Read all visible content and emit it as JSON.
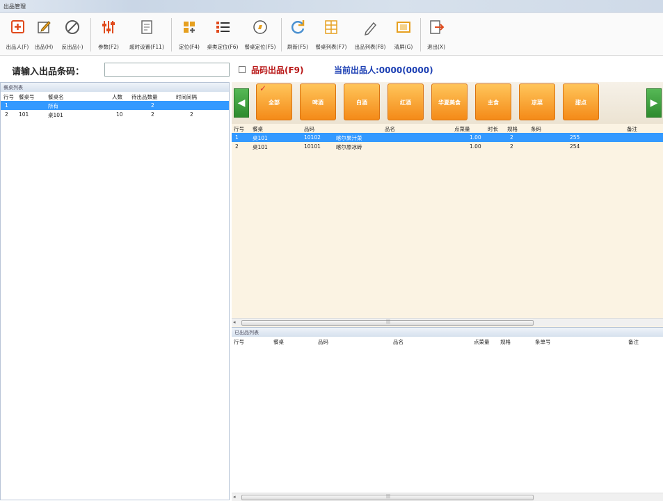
{
  "window": {
    "title": "出品管理"
  },
  "toolbar": {
    "items": [
      {
        "label": "出品人(F)",
        "icon": "plus-box-icon"
      },
      {
        "label": "出品(H)",
        "icon": "edit-icon"
      },
      {
        "label": "反出品(-)",
        "icon": "cancel-circle-icon"
      },
      {
        "label": "参数(F2)",
        "icon": "sliders-icon"
      },
      {
        "label": "超时设置(F11)",
        "icon": "timer-icon"
      },
      {
        "label": "定位(F4)",
        "icon": "grid-plus-icon"
      },
      {
        "label": "桌类定位(F6)",
        "icon": "list-icon"
      },
      {
        "label": "餐桌定位(F5)",
        "icon": "compass-icon"
      },
      {
        "label": "刷新(F5)",
        "icon": "refresh-icon"
      },
      {
        "label": "餐桌列表(F7)",
        "icon": "table-grid-icon"
      },
      {
        "label": "出品列表(F8)",
        "icon": "pencil-icon"
      },
      {
        "label": "清屏(G)",
        "icon": "screen-icon"
      },
      {
        "label": "退出(X)",
        "icon": "exit-icon"
      }
    ]
  },
  "input": {
    "barcode_label": "请输入出品条码：",
    "barcode_value": "",
    "by_code_label": "品码出品(F9)",
    "current_label": "当前出品人:0000(0000)"
  },
  "left": {
    "panel_title": "餐桌列表",
    "headers": [
      "行号",
      "餐桌号",
      "餐桌名",
      "人数",
      "待出品数量",
      "时间间隔"
    ],
    "rows": [
      {
        "no": "1",
        "table_no": "",
        "name": "所有",
        "people": "",
        "pending": "2",
        "interval": ""
      },
      {
        "no": "2",
        "table_no": "101",
        "name": "桌101",
        "people": "10",
        "pending": "2",
        "interval": "2"
      }
    ]
  },
  "categories": [
    "全部",
    "啤酒",
    "白酒",
    "红酒",
    "华夏美食",
    "主食",
    "凉菜",
    "甜点"
  ],
  "items": {
    "headers": [
      "行号",
      "餐桌",
      "品码",
      "品名",
      "点菜量",
      "时长",
      "规格",
      "条码",
      "备注"
    ],
    "rows": [
      {
        "no": "1",
        "table": "桌101",
        "code": "10102",
        "name": "喀尔果汁菜",
        "qty": "1.00",
        "duration": "2",
        "spec": "",
        "barcode": "255",
        "note": ""
      },
      {
        "no": "2",
        "table": "桌101",
        "code": "10101",
        "name": "喀尔原冰砖",
        "qty": "1.00",
        "duration": "2",
        "spec": "",
        "barcode": "254",
        "note": ""
      }
    ]
  },
  "done": {
    "panel_title": "已出品列表",
    "headers": [
      "行号",
      "餐桌",
      "品码",
      "品名",
      "点菜量",
      "规格",
      "条单号",
      "备注"
    ]
  },
  "colors": {
    "accent": "#3399ff",
    "category": "#f7a23a",
    "nav": "#3aa53a",
    "by_code": "#b81616",
    "current": "#1c3fb3"
  }
}
